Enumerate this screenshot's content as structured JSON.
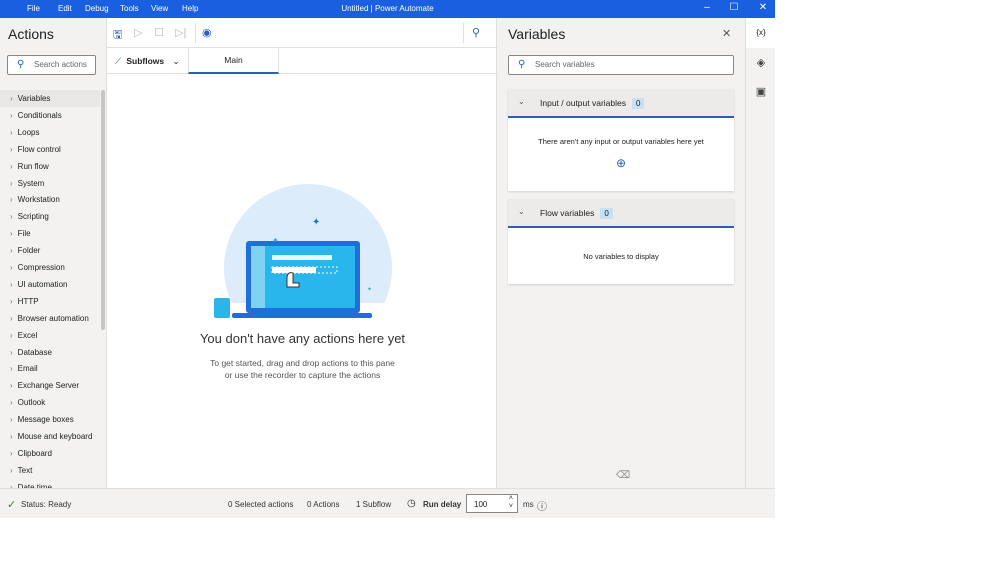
{
  "window": {
    "title": "Untitled | Power Automate",
    "menu": [
      "File",
      "Edit",
      "Debug",
      "Tools",
      "View",
      "Help"
    ]
  },
  "actions": {
    "title": "Actions",
    "search_placeholder": "Search actions",
    "items": [
      "Variables",
      "Conditionals",
      "Loops",
      "Flow control",
      "Run flow",
      "System",
      "Workstation",
      "Scripting",
      "File",
      "Folder",
      "Compression",
      "UI automation",
      "HTTP",
      "Browser automation",
      "Excel",
      "Database",
      "Email",
      "Exchange Server",
      "Outlook",
      "Message boxes",
      "Mouse and keyboard",
      "Clipboard",
      "Text",
      "Date time"
    ]
  },
  "designer": {
    "subflows_label": "Subflows",
    "tab_main": "Main",
    "empty_title": "You don't have any actions here yet",
    "empty_line1": "To get started, drag and drop actions to this pane",
    "empty_line2": "or use the recorder to capture the actions"
  },
  "variables": {
    "title": "Variables",
    "search_placeholder": "Search variables",
    "io": {
      "label": "Input / output variables",
      "count": "0",
      "empty": "There aren't any input or output variables here yet"
    },
    "flow": {
      "label": "Flow variables",
      "count": "0",
      "empty": "No variables to display"
    }
  },
  "rail": {
    "variables_label": "{x}"
  },
  "status": {
    "text": "Status: Ready",
    "selected": "0 Selected actions",
    "actions": "0 Actions",
    "subflows": "1 Subflow",
    "run_delay_label": "Run delay",
    "run_delay_value": "100",
    "unit": "ms"
  },
  "colors": {
    "titlebar": "#1a5fe0",
    "accent": "#2b5fb4"
  }
}
